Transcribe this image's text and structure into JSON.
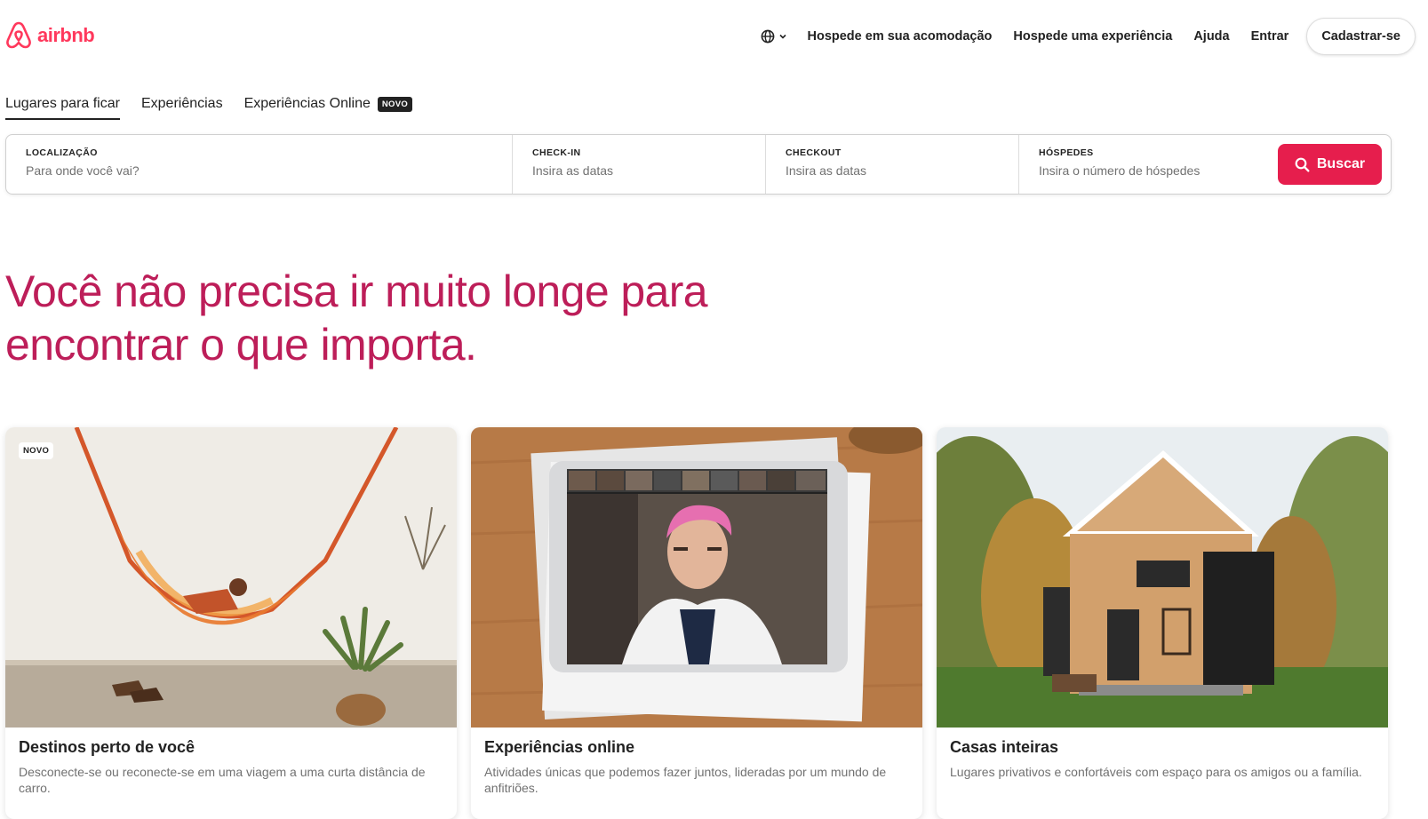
{
  "header": {
    "logo_text": "airbnb",
    "language_icon": "globe-icon",
    "nav_links": [
      "Hospede em sua acomodação",
      "Hospede uma experiência",
      "Ajuda",
      "Entrar"
    ],
    "signup_label": "Cadastrar-se"
  },
  "tabs": [
    {
      "label": "Lugares para ficar",
      "active": true
    },
    {
      "label": "Experiências",
      "active": false
    },
    {
      "label": "Experiências Online",
      "active": false,
      "badge": "NOVO"
    }
  ],
  "search": {
    "location": {
      "label": "LOCALIZAÇÃO",
      "placeholder": "Para onde você vai?"
    },
    "checkin": {
      "label": "CHECK-IN",
      "placeholder": "Insira as datas"
    },
    "checkout": {
      "label": "CHECKOUT",
      "placeholder": "Insira as datas"
    },
    "guests": {
      "label": "HÓSPEDES",
      "placeholder": "Insira o número de hóspedes"
    },
    "button_label": "Buscar"
  },
  "hero": {
    "line1": "Você não precisa ir muito longe para",
    "line2": "encontrar o que importa."
  },
  "cards": [
    {
      "badge": "NOVO",
      "title": "Destinos perto de você",
      "description": "Desconecte-se ou reconecte-se em uma viagem a uma curta distância de carro."
    },
    {
      "title": "Experiências online",
      "description": "Atividades únicas que podemos fazer juntos, lideradas por um mundo de anfitriões."
    },
    {
      "title": "Casas inteiras",
      "description": "Lugares privativos e confortáveis com espaço para os amigos ou a família."
    }
  ],
  "colors": {
    "brand": "#FF385C",
    "search_button": "#E61E4D",
    "hero_text": "#BD1E59"
  }
}
